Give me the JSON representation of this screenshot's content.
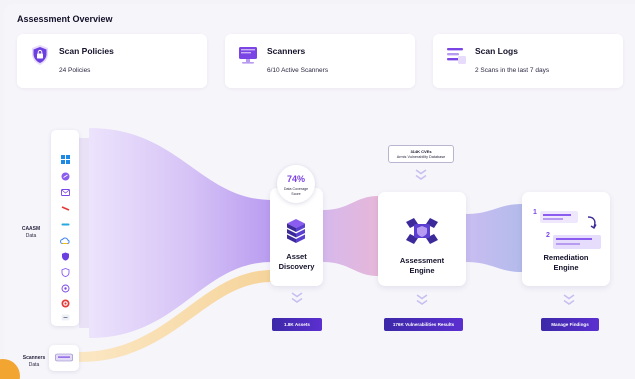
{
  "page": {
    "title": "Assessment Overview"
  },
  "stats": [
    {
      "title": "Scan Policies",
      "subtitle": "24 Policies",
      "icon": "shield-lock-icon"
    },
    {
      "title": "Scanners",
      "subtitle": "6/10 Active Scanners",
      "icon": "monitor-icon"
    },
    {
      "title": "Scan Logs",
      "subtitle": "2 Scans in the last 7 days",
      "icon": "list-icon"
    }
  ],
  "sources": {
    "caasm_label": "CAASM",
    "caasm_sub": "Data",
    "scanners_label": "Scanners",
    "scanners_sub": "Data",
    "icons": [
      "windows-icon",
      "circle-logo-icon",
      "envelope-icon",
      "slash-logo-icon",
      "bar-logo-icon",
      "cloud-icon",
      "shield-icon",
      "shield-outline-icon",
      "crosshair-icon",
      "target-icon",
      "tag-icon"
    ]
  },
  "stages": {
    "discovery": {
      "name_line1": "Asset",
      "name_line2": "Discovery",
      "score": "74%",
      "score_caption_1": "Data Coverage",
      "score_caption_2": "Score",
      "pill": "1.8K Assets"
    },
    "assessment": {
      "name_line1": "Assessment",
      "name_line2": "Engine",
      "cve_line1": "314K CVEs",
      "cve_line2": "Armis Vulnerability Database",
      "pill": "176K Vulnerabilities Results"
    },
    "remediation": {
      "name_line1": "Remediation",
      "name_line2": "Engine",
      "step1": "1",
      "step2": "2",
      "pill": "Manage Findings"
    }
  },
  "colors": {
    "accent": "#6b3fe0",
    "flow_purple": "#c9b3f3",
    "flow_pink": "#e2b6da",
    "flow_blue": "#bcc0ec",
    "flow_orange": "#f9dcaa",
    "pill": "#4a2cbf"
  }
}
